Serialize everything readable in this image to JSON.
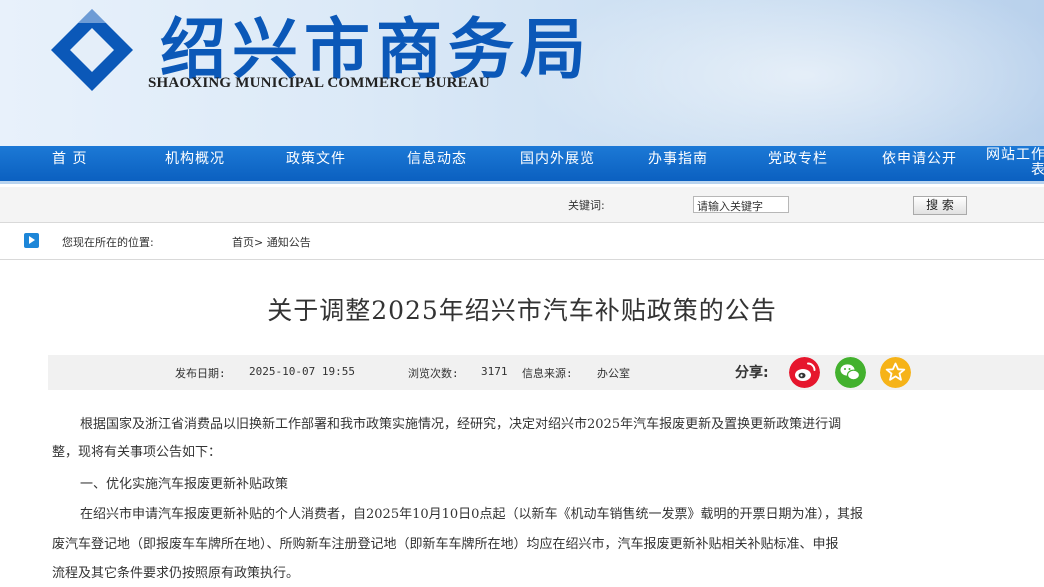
{
  "header": {
    "title_cn": "绍兴市商务局",
    "title_en": "SHAOXING MUNICIPAL COMMERCE BUREAU",
    "logo_icon": "diamond-logo-icon",
    "brand_color": "#0b58b8"
  },
  "nav": {
    "items": [
      "首 页",
      "机构概况",
      "政策文件",
      "信息动态",
      "国内外展览",
      "办事指南",
      "党政专栏",
      "依申请公开",
      "网站工作表"
    ],
    "bar_color": "#0b60c0"
  },
  "search": {
    "label": "关键词:",
    "value": "请输入关键字",
    "button": "搜 索"
  },
  "breadcrumb": {
    "label": "您现在所在的位置:",
    "path": "首页> 通知公告"
  },
  "article": {
    "title": "关于调整2025年绍兴市汽车补贴政策的公告",
    "meta": {
      "date_label": "发布日期:",
      "date": "2025-10-07 19:55",
      "views_label": "浏览次数:",
      "views": "3171",
      "source_label": "信息来源:",
      "source": "办公室",
      "share_label": "分享:",
      "share_icons": [
        "weibo-icon",
        "wechat-icon",
        "favorite-star-icon"
      ]
    },
    "paragraphs": [
      "根据国家及浙江省消费品以旧换新工作部署和我市政策实施情况，经研究，决定对绍兴市2025年汽车报废更新及置换更新政策进行调",
      "整，现将有关事项公告如下：",
      "一、优化实施汽车报废更新补贴政策",
      "在绍兴市申请汽车报废更新补贴的个人消费者，自2025年10月10日0点起（以新车《机动车销售统一发票》载明的开票日期为准），其报",
      "废汽车登记地（即报废车车牌所在地）、所购新车注册登记地（即新车车牌所在地）均应在绍兴市，汽车报废更新补贴相关补贴标准、申报",
      "流程及其它条件要求仍按照原有政策执行。"
    ]
  }
}
